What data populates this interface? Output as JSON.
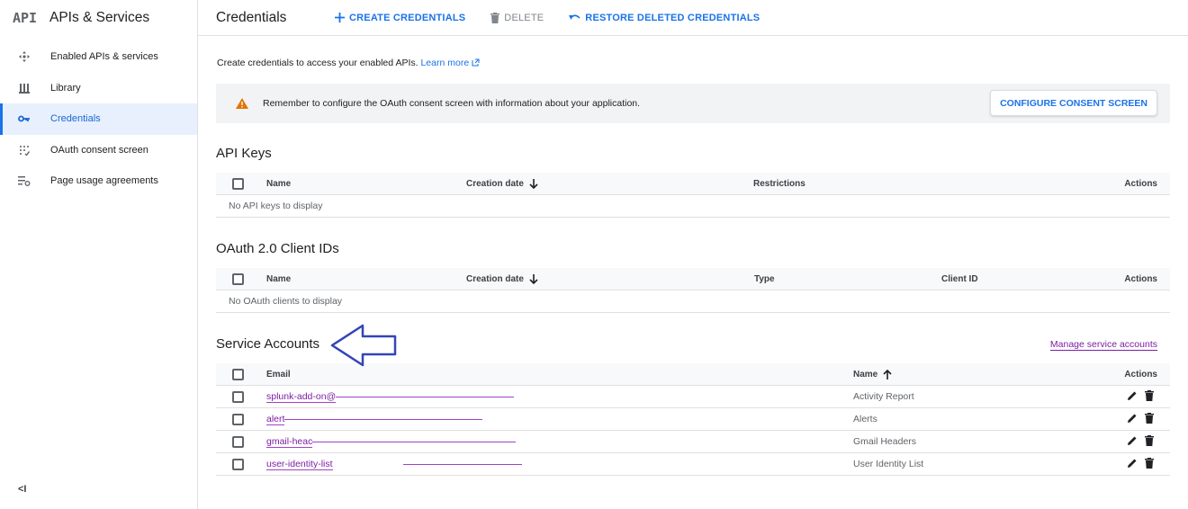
{
  "brand": {
    "logo": "API",
    "title": "APIs & Services"
  },
  "sidebar": {
    "items": [
      {
        "label": "Enabled APIs & services",
        "icon": "enabled-apis-icon",
        "active": false
      },
      {
        "label": "Library",
        "icon": "library-icon",
        "active": false
      },
      {
        "label": "Credentials",
        "icon": "key-icon",
        "active": true
      },
      {
        "label": "OAuth consent screen",
        "icon": "consent-icon",
        "active": false
      },
      {
        "label": "Page usage agreements",
        "icon": "settings-list-icon",
        "active": false
      }
    ],
    "collapse_label": "<I"
  },
  "header": {
    "title": "Credentials",
    "create_label": "CREATE CREDENTIALS",
    "delete_label": "DELETE",
    "restore_label": "RESTORE DELETED CREDENTIALS"
  },
  "intro": {
    "text": "Create credentials to access your enabled APIs.",
    "link": "Learn more"
  },
  "banner": {
    "message": "Remember to configure the OAuth consent screen with information about your application.",
    "button": "CONFIGURE CONSENT SCREEN"
  },
  "api_keys": {
    "title": "API Keys",
    "columns": {
      "name": "Name",
      "creation_date": "Creation date",
      "restrictions": "Restrictions",
      "actions": "Actions"
    },
    "empty": "No API keys to display"
  },
  "oauth": {
    "title": "OAuth 2.0 Client IDs",
    "columns": {
      "name": "Name",
      "creation_date": "Creation date",
      "type": "Type",
      "client_id": "Client ID",
      "actions": "Actions"
    },
    "empty": "No OAuth clients to display"
  },
  "service_accounts": {
    "title": "Service Accounts",
    "manage_link": "Manage service accounts",
    "columns": {
      "email": "Email",
      "name": "Name",
      "actions": "Actions"
    },
    "rows": [
      {
        "email": "splunk-add-on@",
        "name": "Activity Report"
      },
      {
        "email": "alert",
        "name": "Alerts"
      },
      {
        "email": "gmail-heac",
        "name": "Gmail Headers"
      },
      {
        "email": "user-identity-list",
        "name": "User Identity List"
      }
    ]
  },
  "colors": {
    "accent": "#1a73e8",
    "warning": "#e37400",
    "link_visited": "#7b1fa2",
    "annotation": "#3345b8"
  }
}
